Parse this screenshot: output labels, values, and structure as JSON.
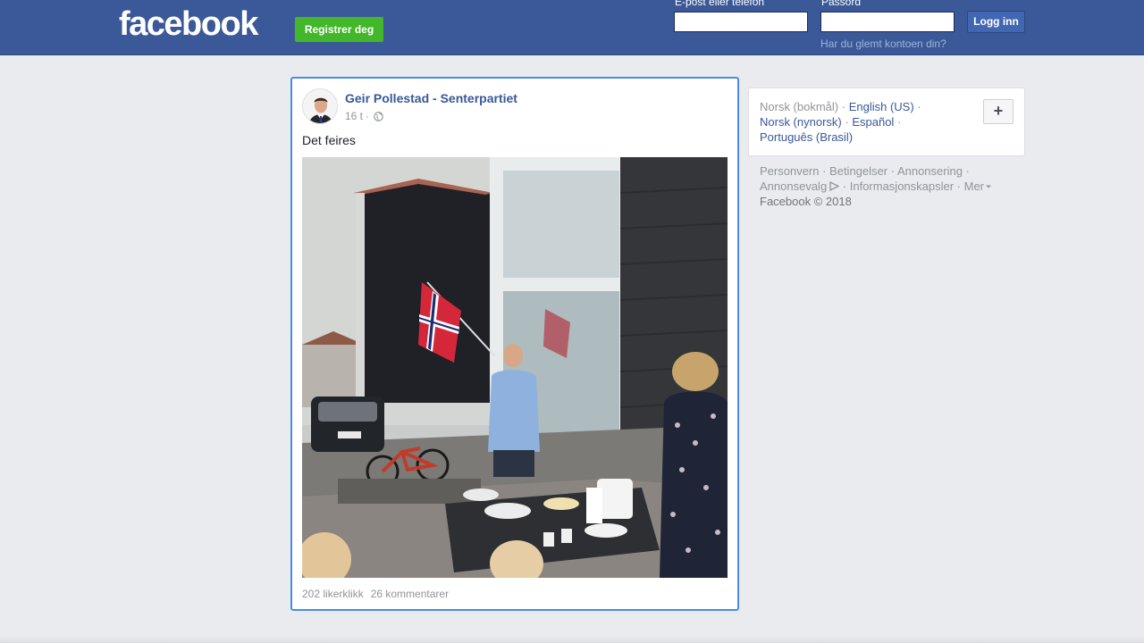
{
  "header": {
    "logo": "facebook",
    "register_label": "Registrer deg",
    "email_label": "E-post eller telefon",
    "password_label": "Passord",
    "email_value": "",
    "password_value": "",
    "login_label": "Logg inn",
    "forgot_label": "Har du glemt kontoen din?"
  },
  "post": {
    "author": "Geir Pollestad - Senterpartiet",
    "time": "16 t",
    "privacy_icon": "globe-icon",
    "text": "Det feires",
    "likes": "202 likerklikk",
    "comments": "26 kommentarer"
  },
  "languages": {
    "current": "Norsk (bokmål)",
    "options": [
      "English (US)",
      "Norsk (nynorsk)",
      "Español",
      "Português (Brasil)"
    ],
    "add_label": "+"
  },
  "footer": {
    "links": [
      "Personvern",
      "Betingelser",
      "Annonsering",
      "Annonsevalg",
      "Informasjonskapsler",
      "Mer"
    ],
    "copyright": "Facebook © 2018"
  },
  "colors": {
    "brand": "#3b5998",
    "register": "#42b72a",
    "link": "#385898",
    "highlight_border": "#4a8ae8"
  }
}
